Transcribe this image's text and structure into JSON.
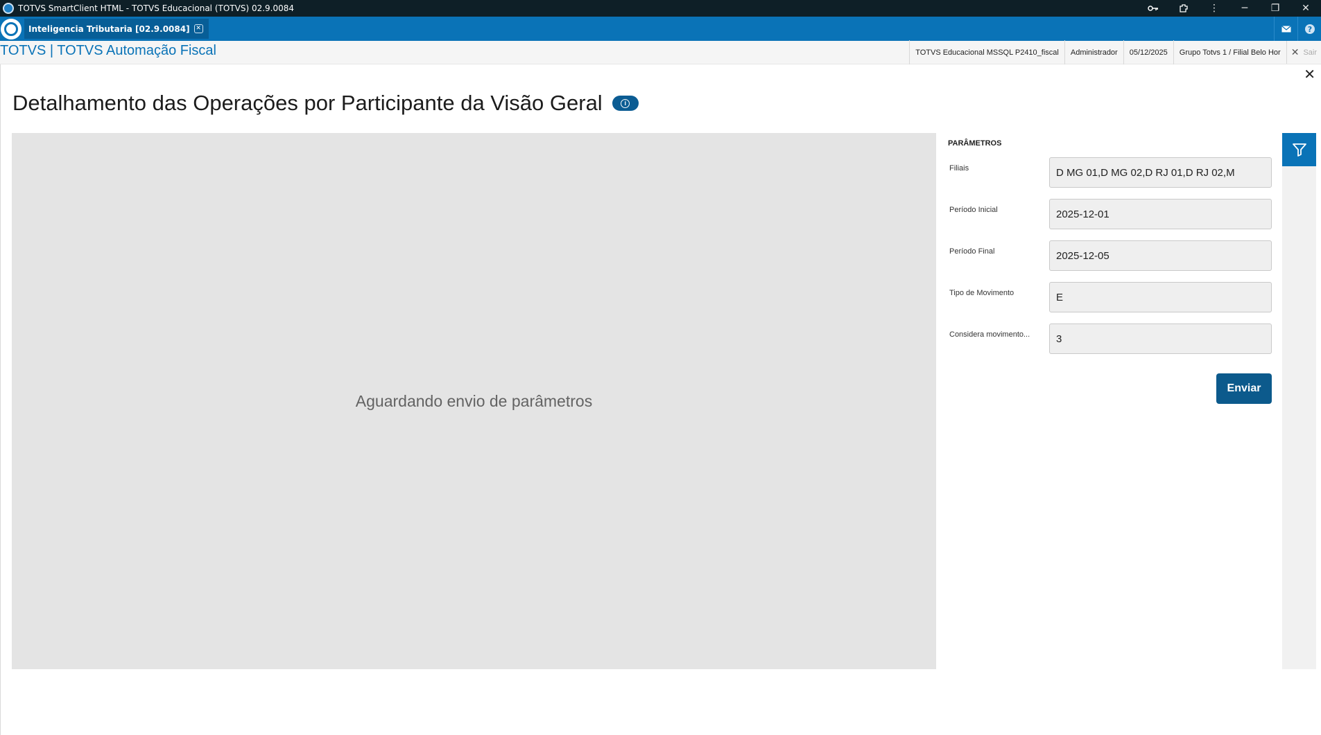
{
  "window": {
    "title": "TOTVS SmartClient HTML - TOTVS Educacional (TOTVS) 02.9.0084",
    "controls": [
      "minimize",
      "restore",
      "close"
    ]
  },
  "tabbar": {
    "tab_label": "Inteligencia Tributaria [02.9.0084]",
    "tab_close": "✕",
    "icons": [
      "mail-icon",
      "help-icon"
    ]
  },
  "header": {
    "brand": "TOTVS | TOTVS Automação Fiscal",
    "environment": "TOTVS Educacional MSSQL P2410_fiscal",
    "user": "Administrador",
    "date": "05/12/2025",
    "branch": "Grupo Totvs 1 / Filial Belo Hor",
    "logout": "Sair"
  },
  "page": {
    "title": "Detalhamento das Operações por Participante da Visão Geral",
    "info_icon": "i"
  },
  "main": {
    "waiting_text": "Aguardando envio de parâmetros"
  },
  "params": {
    "title": "PARÂMETROS",
    "fields": [
      {
        "label": "Filiais",
        "value": "D MG 01,D MG 02,D RJ 01,D RJ 02,M"
      },
      {
        "label": "Período Inicial",
        "value": "2025-12-01"
      },
      {
        "label": "Período Final",
        "value": "2025-12-05"
      },
      {
        "label": "Tipo de Movimento",
        "value": "E"
      },
      {
        "label": "Considera movimento...",
        "value": "3"
      }
    ],
    "submit_label": "Enviar"
  },
  "colors": {
    "titlebar": "#0e1f27",
    "tabbar": "#0a73b7",
    "accent": "#0c5a8c",
    "panel_bg": "#e4e4e4"
  }
}
